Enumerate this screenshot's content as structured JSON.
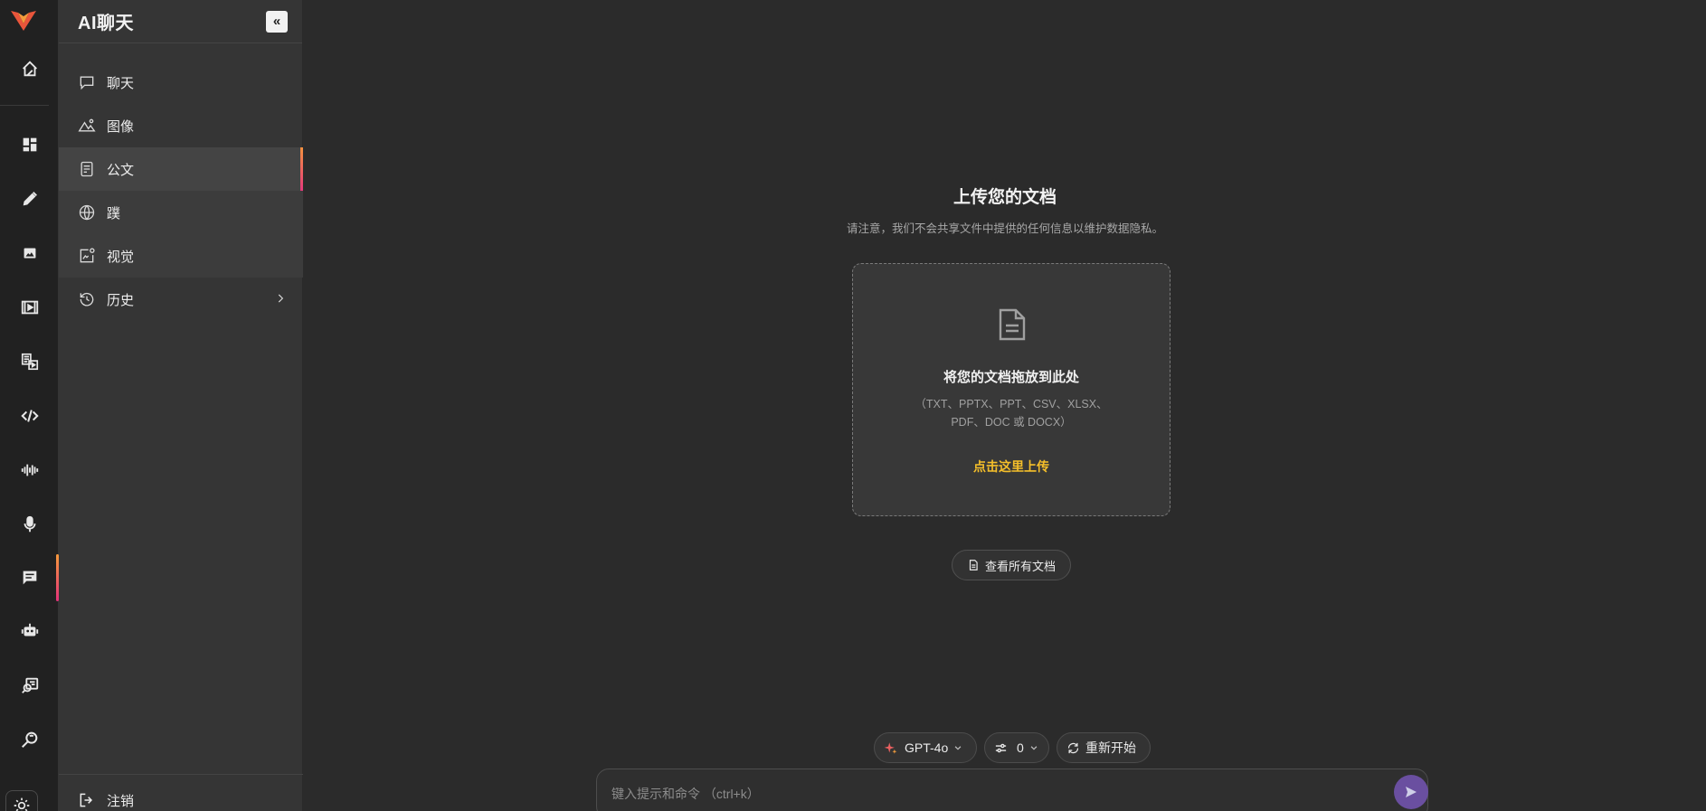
{
  "rail": {
    "icons": [
      "logo",
      "home-icon",
      "dashboard-icon",
      "pen-icon",
      "image-icon",
      "video-icon",
      "media-icon",
      "code-icon",
      "audio-wave-icon",
      "mic-icon",
      "chat-icon",
      "bot-icon",
      "voice-search-icon",
      "search-icon",
      "sun-icon"
    ],
    "active": "chat-icon"
  },
  "sidebar": {
    "title": "AI聊天",
    "collapse_glyph": "«",
    "items": [
      {
        "label": "聊天",
        "icon": "chat-bubble-icon"
      },
      {
        "label": "图像",
        "icon": "image-icon"
      },
      {
        "label": "公文",
        "icon": "document-icon"
      },
      {
        "label": "蹼",
        "icon": "globe-icon"
      },
      {
        "label": "视觉",
        "icon": "vision-icon"
      },
      {
        "label": "历史",
        "icon": "history-icon"
      }
    ],
    "active_item": "公文",
    "logout": "注销"
  },
  "upload": {
    "title": "上传您的文档",
    "note": "请注意，我们不会共享文件中提供的任何信息以维护数据隐私。",
    "drop_title": "将您的文档拖放到此处",
    "formats": "（TXT、PPTX、PPT、CSV、XLSX、PDF、DOC 或 DOCX）",
    "link": "点击这里上传",
    "view_all": "查看所有文档"
  },
  "controls": {
    "model": "GPT-4o",
    "count": "0",
    "restart": "重新开始"
  },
  "prompt": {
    "placeholder": "键入提示和命令 （ctrl+k）"
  },
  "colors": {
    "accent_gradient_start": "#f79a3b",
    "accent_gradient_end": "#e5317a",
    "upload_link": "#f5bf2a",
    "send_button": "#6a4fa0"
  }
}
